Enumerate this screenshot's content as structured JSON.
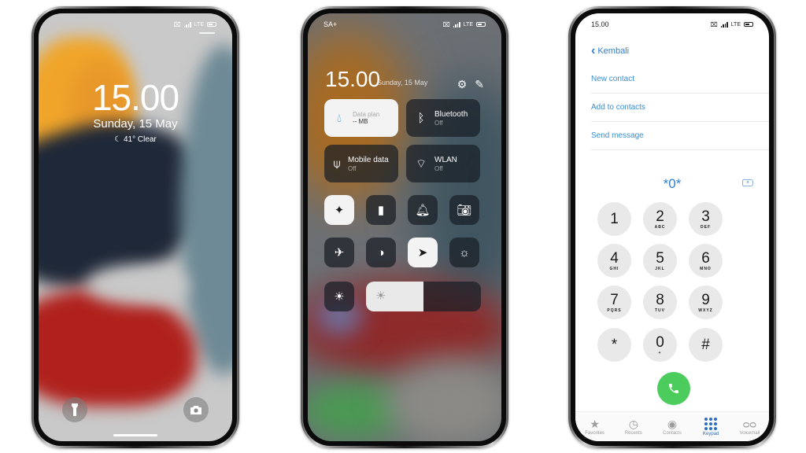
{
  "lock_screen": {
    "status": {
      "network": "LTE",
      "no_sim_icon": "no-sim-icon",
      "signal_icon": "signal-icon",
      "battery_icon": "battery-icon"
    },
    "time": "15.00",
    "date": "Sunday, 15 May",
    "weather": {
      "icon": "moon-icon",
      "text": "41° Clear"
    },
    "flashlight_icon": "flashlight-icon",
    "camera_icon": "camera-icon"
  },
  "control_center": {
    "status": {
      "carrier": "SA+",
      "network": "LTE"
    },
    "time": "15.00",
    "date": "Sunday, 15 May",
    "header_icons": [
      "settings-icon",
      "edit-icon"
    ],
    "tiles": [
      {
        "id": "data-plan",
        "icon": "drop-icon",
        "label": "Data plan",
        "value": "-- MB",
        "active": true
      },
      {
        "id": "bluetooth",
        "icon": "bluetooth-off-icon",
        "label": "Bluetooth",
        "value": "Off",
        "active": false
      },
      {
        "id": "mobile-data",
        "icon": "antenna-icon",
        "label": "Mobile data",
        "value": "Off",
        "active": false
      },
      {
        "id": "wlan",
        "icon": "wifi-off-icon",
        "label": "WLAN",
        "value": "Off",
        "active": false
      }
    ],
    "toggles_row1": [
      {
        "id": "sound-wave",
        "icon": "waveform-icon",
        "active": true
      },
      {
        "id": "flashlight",
        "icon": "flashlight-icon",
        "active": false
      },
      {
        "id": "bell",
        "icon": "bell-icon",
        "active": false
      },
      {
        "id": "screenshot",
        "icon": "camera-icon",
        "active": false
      }
    ],
    "toggles_row2": [
      {
        "id": "airplane",
        "icon": "airplane-icon",
        "active": false
      },
      {
        "id": "reading-mode",
        "icon": "contrast-icon",
        "active": false
      },
      {
        "id": "location",
        "icon": "location-arrow-icon",
        "active": true
      },
      {
        "id": "dark-mode",
        "icon": "dark-mode-icon",
        "active": false
      }
    ],
    "auto_brightness": {
      "icon": "auto-brightness-icon"
    },
    "brightness": {
      "icon": "sun-icon",
      "level_percent": 50
    }
  },
  "dialer": {
    "status": {
      "time": "15.00",
      "network": "LTE"
    },
    "back_label": "Kembali",
    "menu": [
      "New contact",
      "Add to contacts",
      "Send message"
    ],
    "entered_number": "*0*",
    "delete_icon": "backspace-icon",
    "keys": [
      {
        "digit": "1",
        "letters": ""
      },
      {
        "digit": "2",
        "letters": "ABC"
      },
      {
        "digit": "3",
        "letters": "DEF"
      },
      {
        "digit": "4",
        "letters": "GHI"
      },
      {
        "digit": "5",
        "letters": "JKL"
      },
      {
        "digit": "6",
        "letters": "MNO"
      },
      {
        "digit": "7",
        "letters": "PQRS"
      },
      {
        "digit": "8",
        "letters": "TUV"
      },
      {
        "digit": "9",
        "letters": "WXYZ"
      },
      {
        "digit": "*",
        "letters": ""
      },
      {
        "digit": "0",
        "letters": "+"
      },
      {
        "digit": "#",
        "letters": ""
      }
    ],
    "call_icon": "phone-icon",
    "tabs": [
      {
        "label": "Favorites",
        "icon": "star-icon",
        "active": false
      },
      {
        "label": "Recents",
        "icon": "clock-icon",
        "active": false
      },
      {
        "label": "Contacts",
        "icon": "person-circle-icon",
        "active": false
      },
      {
        "label": "Keypad",
        "icon": "keypad-icon",
        "active": true
      },
      {
        "label": "Voicemail",
        "icon": "voicemail-icon",
        "active": false
      }
    ],
    "colors": {
      "accent": "#2d7fd0",
      "call": "#4ccc5c",
      "key_bg": "#e9e9e9"
    }
  }
}
